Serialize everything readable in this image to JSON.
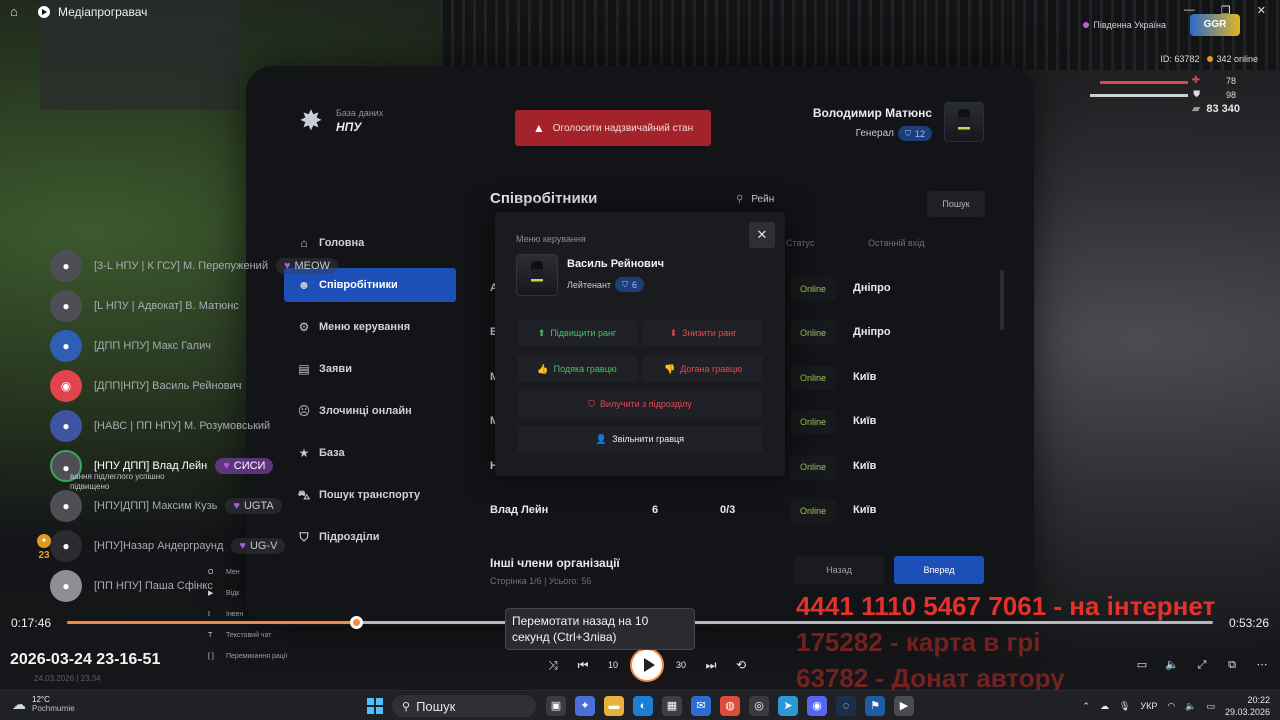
{
  "player": {
    "title": "Медіапрогравач",
    "time_current": "0:17:46",
    "time_total": "0:53:26",
    "progress": 0.252,
    "tooltip": "Перемотати назад на 10 секунд (Ctrl+Зліва)",
    "filename": "2026-03-24 23-16-51",
    "ghost_date": "24.03.2026 | 23:34",
    "buttons": [
      "shuffle",
      "previous",
      "rewind-10",
      "play",
      "forward-30",
      "next",
      "repeat-off"
    ],
    "rewind_label": "10",
    "forward_label": "30"
  },
  "hud": {
    "region": "Південна Україна",
    "logo": "GGR",
    "id_label": "ID: 63782",
    "online": "342 online",
    "health": "78",
    "armor": "98",
    "money": "83 340"
  },
  "tablet": {
    "brand_caption": "База даних",
    "brand_name": "НПУ",
    "nav": [
      {
        "label": "Головна",
        "icon": "home-icon"
      },
      {
        "label": "Співробітники",
        "icon": "users-icon",
        "active": true
      },
      {
        "label": "Меню керування",
        "icon": "gear-icon"
      },
      {
        "label": "Заяви",
        "icon": "inbox-icon"
      },
      {
        "label": "Злочинці онлайн",
        "icon": "mask-icon"
      },
      {
        "label": "База",
        "icon": "star-icon"
      },
      {
        "label": "Пошук транспорту",
        "icon": "car-icon"
      },
      {
        "label": "Підрозділи",
        "icon": "shield-icon"
      }
    ],
    "emergency_button": "Оголосити надзвичайний стан",
    "profile_name": "Володимир Матюнс",
    "profile_rank": "Генерал",
    "profile_level": "12",
    "section_title": "Співробітники",
    "search_value": "Рейн",
    "search_button": "Пошук",
    "columns": [
      "Статус",
      "Останній вхід"
    ],
    "rows": [
      {
        "name": "А",
        "rank": "",
        "warns": "",
        "status": "Online",
        "city": "Дніпро"
      },
      {
        "name": "В",
        "rank": "",
        "warns": "",
        "status": "Online",
        "city": "Дніпро"
      },
      {
        "name": "М",
        "rank": "",
        "warns": "",
        "status": "Online",
        "city": "Київ"
      },
      {
        "name": "М",
        "rank": "",
        "warns": "",
        "status": "Online",
        "city": "Київ"
      },
      {
        "name": "Н",
        "rank": "",
        "warns": "",
        "status": "Online",
        "city": "Київ"
      },
      {
        "name": "Влад Лейн",
        "rank": "6",
        "warns": "0/3",
        "status": "Online",
        "city": "Київ"
      }
    ],
    "others_title": "Інші члени організації",
    "page_info": "Сторінка 1/6 | Усього: 56",
    "back_button": "Назад",
    "next_button": "Вперед"
  },
  "modal": {
    "caption": "Меню керування",
    "name": "Василь Рейнович",
    "rank": "Лейтенант",
    "level": "6",
    "promote": "Підвищити ранг",
    "demote": "Знизити ранг",
    "thank": "Подяка гравцю",
    "reprimand": "Догана гравцю",
    "remove_unit": "Вилучити з підрозділу",
    "fire": "Звільнити гравця"
  },
  "chat": [
    {
      "name": "[3-L НПУ | К ГСУ] М. Перепужений",
      "tag": "MEOW"
    },
    {
      "name": "[L НПУ | Адвокат] В. Матюнс",
      "tag": ""
    },
    {
      "name": "[ДПП НПУ] Макс Галич",
      "tag": ""
    },
    {
      "name": "[ДПП|НПУ] Василь Рейнович",
      "tag": ""
    },
    {
      "name": "[НАВС | ПП НПУ] М. Розумовський",
      "tag": ""
    },
    {
      "name": "[НПУ ДПП] Влад Лейн",
      "tag": "СИСИ",
      "highlight": true
    },
    {
      "name": "[НПУ|ДПП] Максим Кузь",
      "tag": "UGTA"
    },
    {
      "name": "[НПУ]Назар Андерграунд",
      "tag": "UG-V"
    },
    {
      "name": "[ПП НПУ] Паша Сфінкс",
      "tag": ""
    }
  ],
  "notification": "вання підлеглого успішно підвищено",
  "level_badge": "23",
  "keymenu": [
    {
      "key": "O",
      "label": "Мен"
    },
    {
      "key": "▶",
      "label": "Відк"
    },
    {
      "key": "I",
      "label": "Інвен"
    },
    {
      "key": "T",
      "label": "Текстовий чат"
    },
    {
      "key": "[ ]",
      "label": "Перемикання рації"
    }
  ],
  "overlay": {
    "line1": "4441 1110 5467 7061 - на інтернет",
    "line2": "175282 - карта в грі",
    "line3": "63782 - Донат автору"
  },
  "taskbar": {
    "weather_temp": "12°C",
    "weather_desc": "Pochmurnie",
    "search_label": "Пошук",
    "lang": "УКР",
    "time": "20:22",
    "date": "29.03.2026"
  },
  "colors": {
    "accent": "#1d4fb8",
    "emergency": "#a4222a",
    "online": "#9fc45a",
    "progress": "#f08a3e",
    "overlay_red": "#e4312a"
  }
}
